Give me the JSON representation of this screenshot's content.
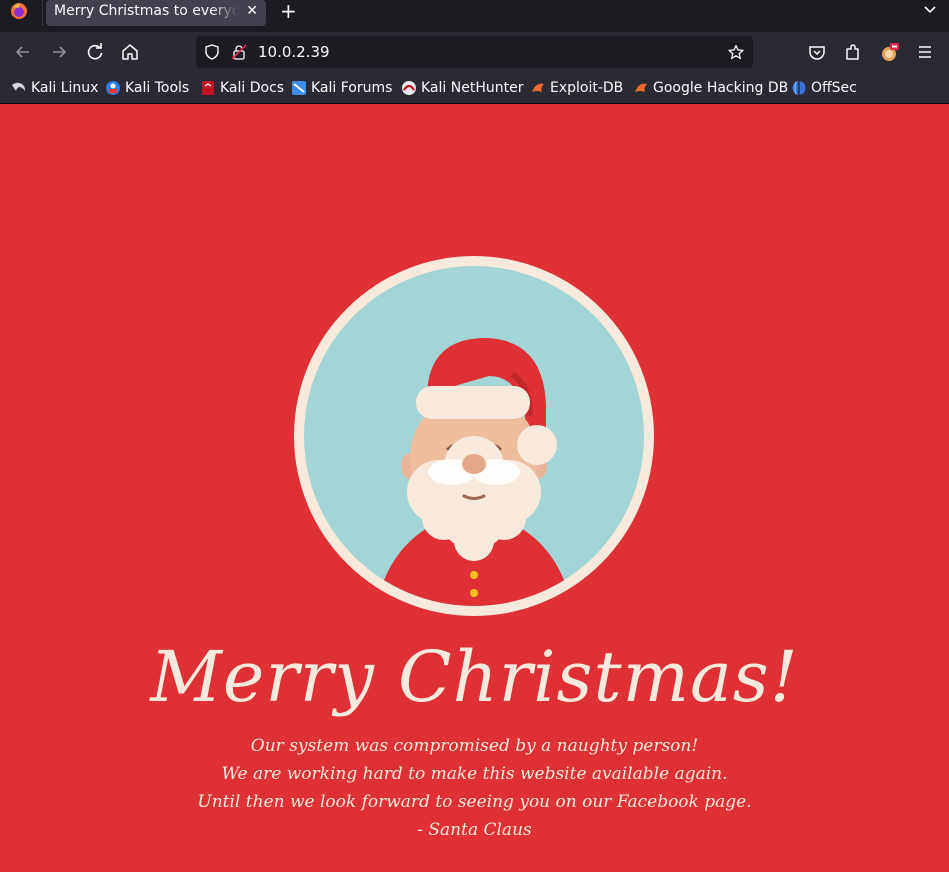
{
  "browser": {
    "tab": {
      "title": "Merry Christmas to everyone"
    },
    "url": "10.0.2.39",
    "bookmarks": [
      {
        "label": "Kali Linux",
        "icon": "kali-dragon-icon"
      },
      {
        "label": "Kali Tools",
        "icon": "kali-tools-icon"
      },
      {
        "label": "Kali Docs",
        "icon": "kali-docs-icon"
      },
      {
        "label": "Kali Forums",
        "icon": "kali-forums-icon"
      },
      {
        "label": "Kali NetHunter",
        "icon": "nethunter-icon"
      },
      {
        "label": "Exploit-DB",
        "icon": "exploit-db-icon"
      },
      {
        "label": "Google Hacking DB",
        "icon": "ghdb-icon"
      },
      {
        "label": "OffSec",
        "icon": "offsec-icon"
      }
    ]
  },
  "page": {
    "headline": "Merry Christmas!",
    "message_lines": [
      "Our system was compromised by a naughty person!",
      "We are working hard to make this website available again.",
      "Until then we look forward to seeing you on our Facebook page.",
      "- Santa Claus"
    ],
    "colors": {
      "background": "#de3035",
      "circle_ring": "#f8e9dd",
      "circle_fill": "#a3d5d6",
      "text": "#f8e9dd"
    }
  }
}
